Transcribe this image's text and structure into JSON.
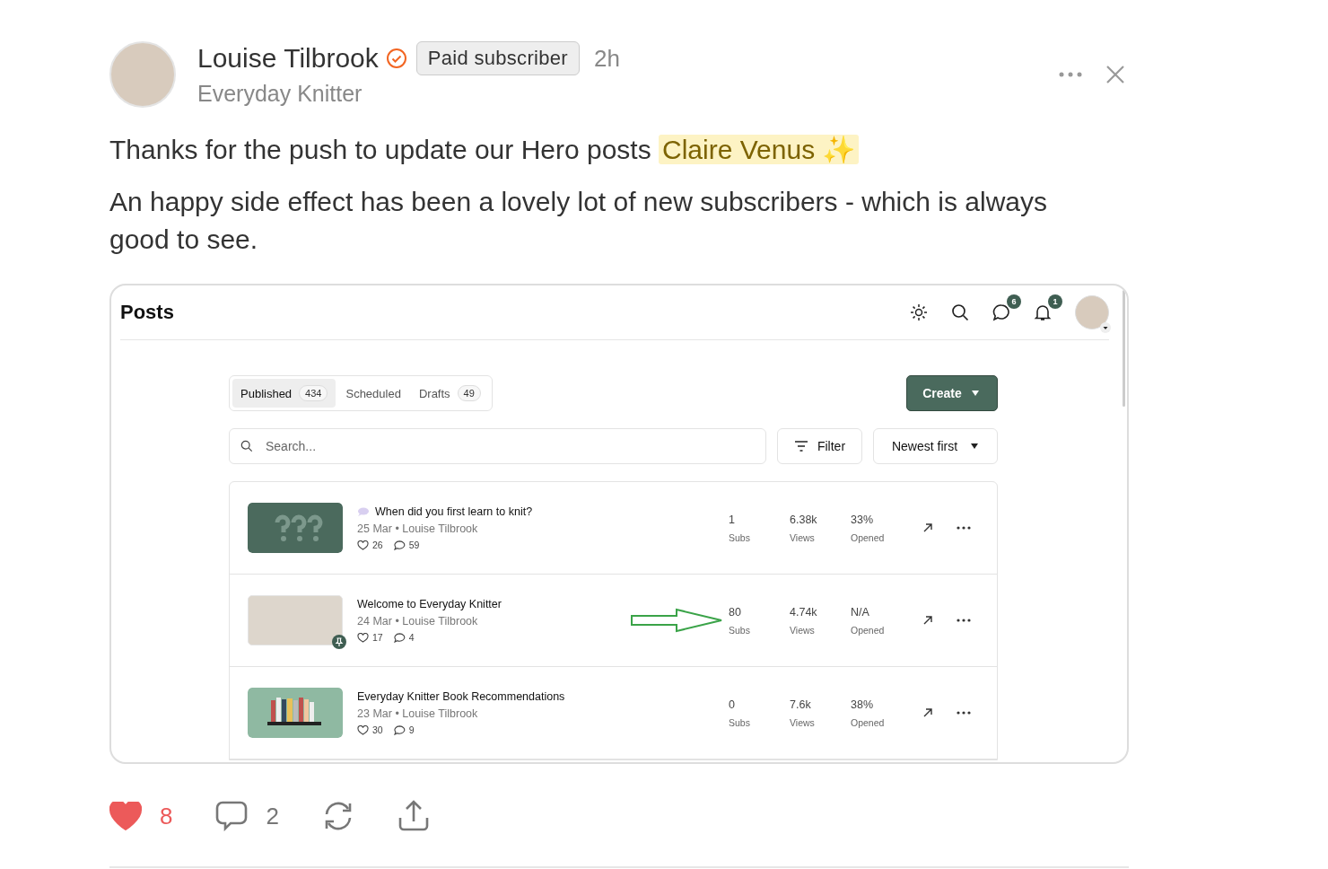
{
  "author": {
    "name": "Louise Tilbrook",
    "verified": true,
    "badge": "Paid subscriber",
    "time": "2h",
    "publication": "Everyday Knitter"
  },
  "body": {
    "line_1": "Thanks for the push to update our Hero posts",
    "mention": "Claire Venus",
    "mention_emoji": "✨",
    "line_2": "An happy side effect has been a lovely lot of new subscribers - which is always good to see."
  },
  "embed": {
    "title": "Posts",
    "message_count": "6",
    "notification_count": "1",
    "tabs": [
      {
        "label": "Published",
        "count": "434",
        "selected": true
      },
      {
        "label": "Scheduled",
        "selected": false
      },
      {
        "label": "Drafts",
        "count": "49",
        "selected": false
      }
    ],
    "create_button": "Create",
    "search": {
      "placeholder": "Search..."
    },
    "filter_button": "Filter",
    "sort": "Newest first",
    "posts": [
      {
        "kind": "question",
        "chat": true,
        "pinned": false,
        "title": "When did you first learn to knit?",
        "meta": "25 Mar • Louise Tilbrook",
        "likes": "26",
        "comments": "59",
        "subs": "1",
        "subs_label": "Subs",
        "views": "6.38k",
        "views_label": "Views",
        "opened": "33%",
        "opened_label": "Opened",
        "arrow": false
      },
      {
        "kind": "photo",
        "chat": false,
        "pinned": true,
        "title": "Welcome to Everyday Knitter",
        "meta": "24 Mar • Louise Tilbrook",
        "likes": "17",
        "comments": "4",
        "subs": "80",
        "subs_label": "Subs",
        "views": "4.74k",
        "views_label": "Views",
        "opened": "N/A",
        "opened_label": "Opened",
        "arrow": true
      },
      {
        "kind": "books",
        "chat": false,
        "pinned": false,
        "title": "Everyday Knitter Book Recommendations",
        "meta": "23 Mar • Louise Tilbrook",
        "likes": "30",
        "comments": "9",
        "subs": "0",
        "subs_label": "Subs",
        "views": "7.6k",
        "views_label": "Views",
        "opened": "38%",
        "opened_label": "Opened",
        "arrow": false
      }
    ]
  },
  "actions": {
    "liked": true,
    "likes": "8",
    "comments": "2"
  }
}
